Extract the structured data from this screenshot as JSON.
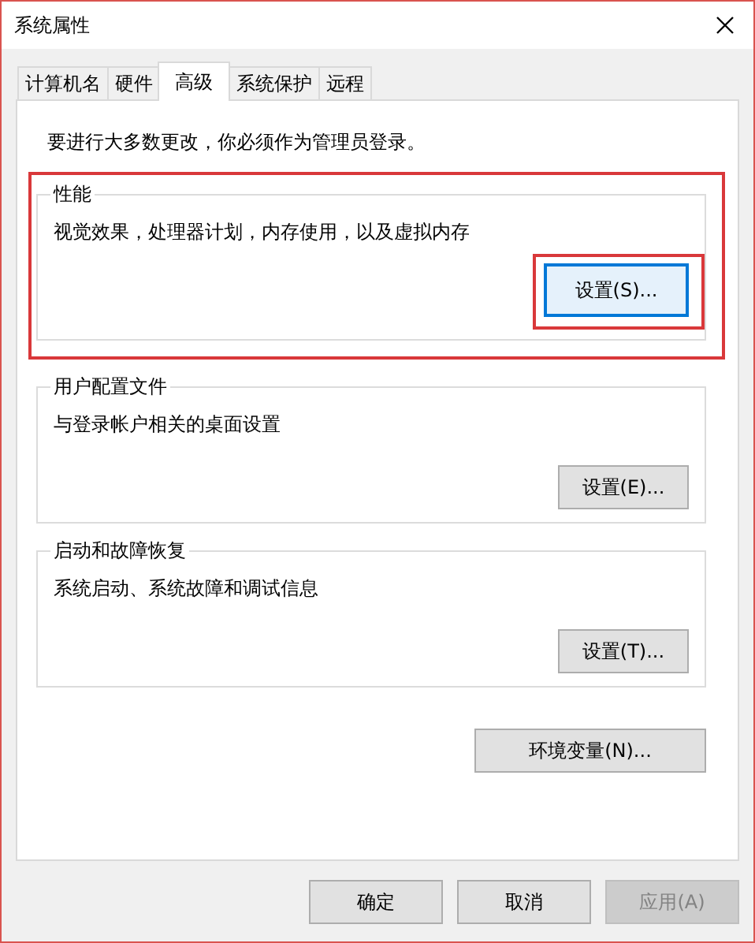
{
  "window": {
    "title": "系统属性"
  },
  "tabs": [
    {
      "label": "计算机名",
      "selected": false
    },
    {
      "label": "硬件",
      "selected": false
    },
    {
      "label": "高级",
      "selected": true
    },
    {
      "label": "系统保护",
      "selected": false
    },
    {
      "label": "远程",
      "selected": false
    }
  ],
  "notice": "要进行大多数更改，你必须作为管理员登录。",
  "groups": [
    {
      "title": "性能",
      "description": "视觉效果，处理器计划，内存使用，以及虚拟内存",
      "highlighted": true,
      "button": {
        "label": "设置(S)...",
        "highlighted": true
      }
    },
    {
      "title": "用户配置文件",
      "description": "与登录帐户相关的桌面设置",
      "highlighted": false,
      "button": {
        "label": "设置(E)...",
        "highlighted": false
      }
    },
    {
      "title": "启动和故障恢复",
      "description": "系统启动、系统故障和调试信息",
      "highlighted": false,
      "button": {
        "label": "设置(T)...",
        "highlighted": false
      }
    }
  ],
  "env_button": "环境变量(N)...",
  "buttons": [
    {
      "label": "确定",
      "disabled": false
    },
    {
      "label": "取消",
      "disabled": false
    },
    {
      "label": "应用(A)",
      "disabled": true
    }
  ]
}
